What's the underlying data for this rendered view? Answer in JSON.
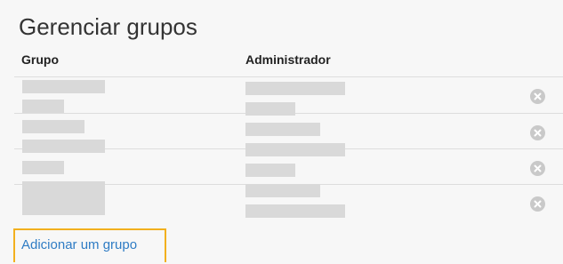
{
  "page": {
    "title": "Gerenciar grupos"
  },
  "table": {
    "columns": [
      "Grupo",
      "Administrador"
    ],
    "rows": [
      {
        "group": "",
        "admin": "",
        "remove_icon": "remove-circle-icon"
      },
      {
        "group": "",
        "admin": "",
        "remove_icon": "remove-circle-icon"
      },
      {
        "group": "",
        "admin": "",
        "remove_icon": "remove-circle-icon"
      },
      {
        "group": "",
        "admin": "",
        "remove_icon": "remove-circle-icon"
      }
    ]
  },
  "actions": {
    "add_group_label": "Adicionar um grupo"
  },
  "colors": {
    "accent_link": "#2f7cc4",
    "highlight_border": "#f2b01e",
    "redacted_bar": "#d9d9d9"
  }
}
